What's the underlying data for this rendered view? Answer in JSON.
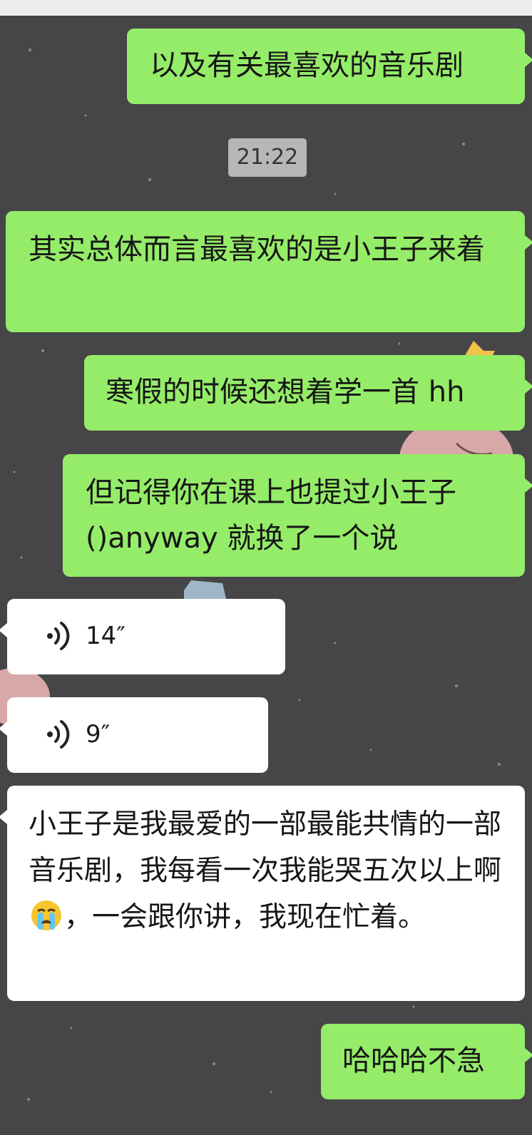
{
  "messages": [
    {
      "id": "m1",
      "side": "right",
      "text": "以及有关最喜欢的音乐剧"
    },
    {
      "id": "m2",
      "side": "right",
      "text": "其实总体而言最喜欢的是小王子来着"
    },
    {
      "id": "m3",
      "side": "right",
      "text": "寒假的时候还想着学一首 hh"
    },
    {
      "id": "m4",
      "side": "right",
      "text_line1": "但记得你在课上也提过小王子",
      "text_line2": "()anyway 就换了一个说"
    },
    {
      "id": "v1",
      "side": "left",
      "type": "voice",
      "duration": "14″"
    },
    {
      "id": "v2",
      "side": "left",
      "type": "voice",
      "duration": "9″"
    },
    {
      "id": "m5",
      "side": "left",
      "text_before_emoji": "小王子是我最爱的一部最能共情的一部音乐剧，我每看一次我能哭五次以上啊",
      "emoji": "crying-face",
      "text_after_emoji": "，一会跟你讲，我现在忙着。"
    },
    {
      "id": "m6",
      "side": "right",
      "text": "哈哈哈不急"
    }
  ],
  "timestamp": "21:22",
  "colors": {
    "background": "#464548",
    "sent_bubble": "#95ec69",
    "received_bubble": "#ffffff",
    "timestamp_bg": "#b7b7b7"
  },
  "icons": {
    "voice": "voice-wave-icon",
    "emoji": "crying-face-emoji"
  }
}
